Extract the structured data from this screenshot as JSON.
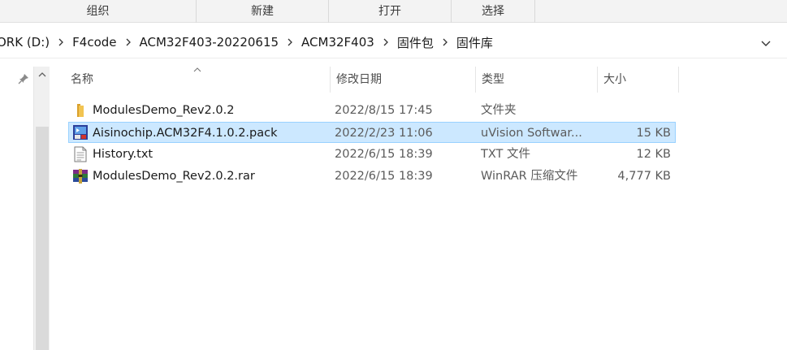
{
  "ribbon": {
    "groups": [
      "组织",
      "新建",
      "打开",
      "选择"
    ]
  },
  "address": {
    "crumbs": [
      "ORK (D:)",
      "F4code",
      "ACM32F403-20220615",
      "ACM32F403",
      "固件包",
      "固件库"
    ]
  },
  "columns": {
    "name": "名称",
    "modified": "修改日期",
    "type": "类型",
    "size": "大小"
  },
  "files": [
    {
      "name": "ModulesDemo_Rev2.0.2",
      "modified": "2022/8/15 17:45",
      "type": "文件夹",
      "size": "",
      "icon": "folder-icon"
    },
    {
      "name": "Aisinochip.ACM32F4.1.0.2.pack",
      "modified": "2022/2/23 11:06",
      "type": "uVision Softwar...",
      "size": "15 KB",
      "icon": "pack-file-icon",
      "selected": true
    },
    {
      "name": "History.txt",
      "modified": "2022/6/15 18:39",
      "type": "TXT 文件",
      "size": "12 KB",
      "icon": "text-file-icon"
    },
    {
      "name": "ModulesDemo_Rev2.0.2.rar",
      "modified": "2022/6/15 18:39",
      "type": "WinRAR 压缩文件",
      "size": "4,777 KB",
      "icon": "rar-archive-icon"
    }
  ],
  "colors": {
    "selection_bg": "#cce8ff",
    "selection_border": "#99d1ff",
    "folder": "#e8b23a"
  }
}
